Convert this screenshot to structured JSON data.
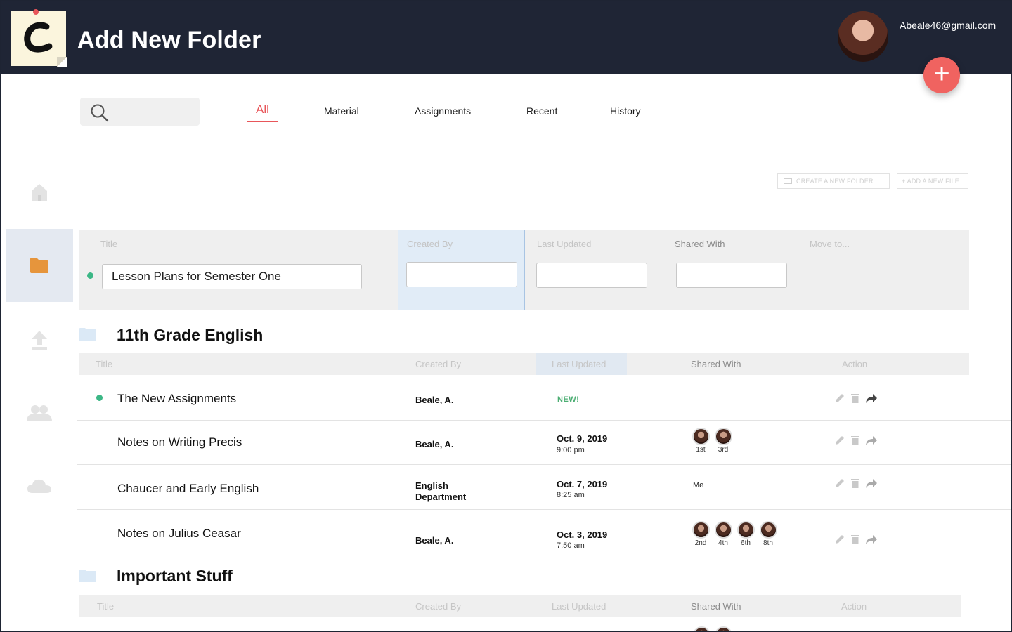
{
  "header": {
    "title": "Add New Folder",
    "user_email": "Abeale46@gmail.com",
    "fab_label": "+"
  },
  "sidebar": {
    "items": [
      {
        "icon": "home-icon"
      },
      {
        "icon": "folder-icon",
        "active": true
      },
      {
        "icon": "upload-icon"
      },
      {
        "icon": "users-icon"
      },
      {
        "icon": "cloud-icon"
      }
    ]
  },
  "tabs": [
    "All",
    "Material",
    "Assignments",
    "Recent",
    "History"
  ],
  "toolbar": {
    "create_folder": "CREATE A NEW FOLDER",
    "add_file": "+ ADD A NEW FILE"
  },
  "new_folder": {
    "headers": {
      "title": "Title",
      "created_by": "Created By",
      "last_updated": "Last Updated",
      "shared_with": "Shared With",
      "move_to": "Move to..."
    },
    "title_value": "Lesson Plans for Semester One"
  },
  "sections": [
    {
      "title": "11th Grade English",
      "headers": {
        "title": "Title",
        "created_by": "Created By",
        "last_updated": "Last Updated",
        "shared_with": "Shared With",
        "action": "Action"
      },
      "rows": [
        {
          "title": "The New Assignments",
          "created_by": "Beale, A.",
          "badge": "NEW!"
        },
        {
          "title": "Notes on Writing Precis",
          "created_by": "Beale, A.",
          "date": "Oct. 9, 2019",
          "time": "9:00 pm",
          "shared": [
            "1st",
            "3rd"
          ]
        },
        {
          "title": "Chaucer and Early English",
          "created_by_line1": "English",
          "created_by_line2": "Department",
          "date": "Oct. 7, 2019",
          "time": "8:25 am",
          "shared_text": "Me"
        },
        {
          "title": "Notes on Julius Ceasar",
          "created_by": "Beale, A.",
          "date": "Oct. 3, 2019",
          "time": "7:50 am",
          "shared": [
            "2nd",
            "4th",
            "6th",
            "8th"
          ]
        }
      ]
    },
    {
      "title": "Important Stuff",
      "headers": {
        "title": "Title",
        "created_by": "Created By",
        "last_updated": "Last Updated",
        "shared_with": "Shared With",
        "action": "Action"
      }
    }
  ],
  "colors": {
    "header_bg": "#1f2535",
    "accent": "#e8565a",
    "fab": "#f06360",
    "new_badge": "#4cae73",
    "status_dot": "#3cb786"
  }
}
